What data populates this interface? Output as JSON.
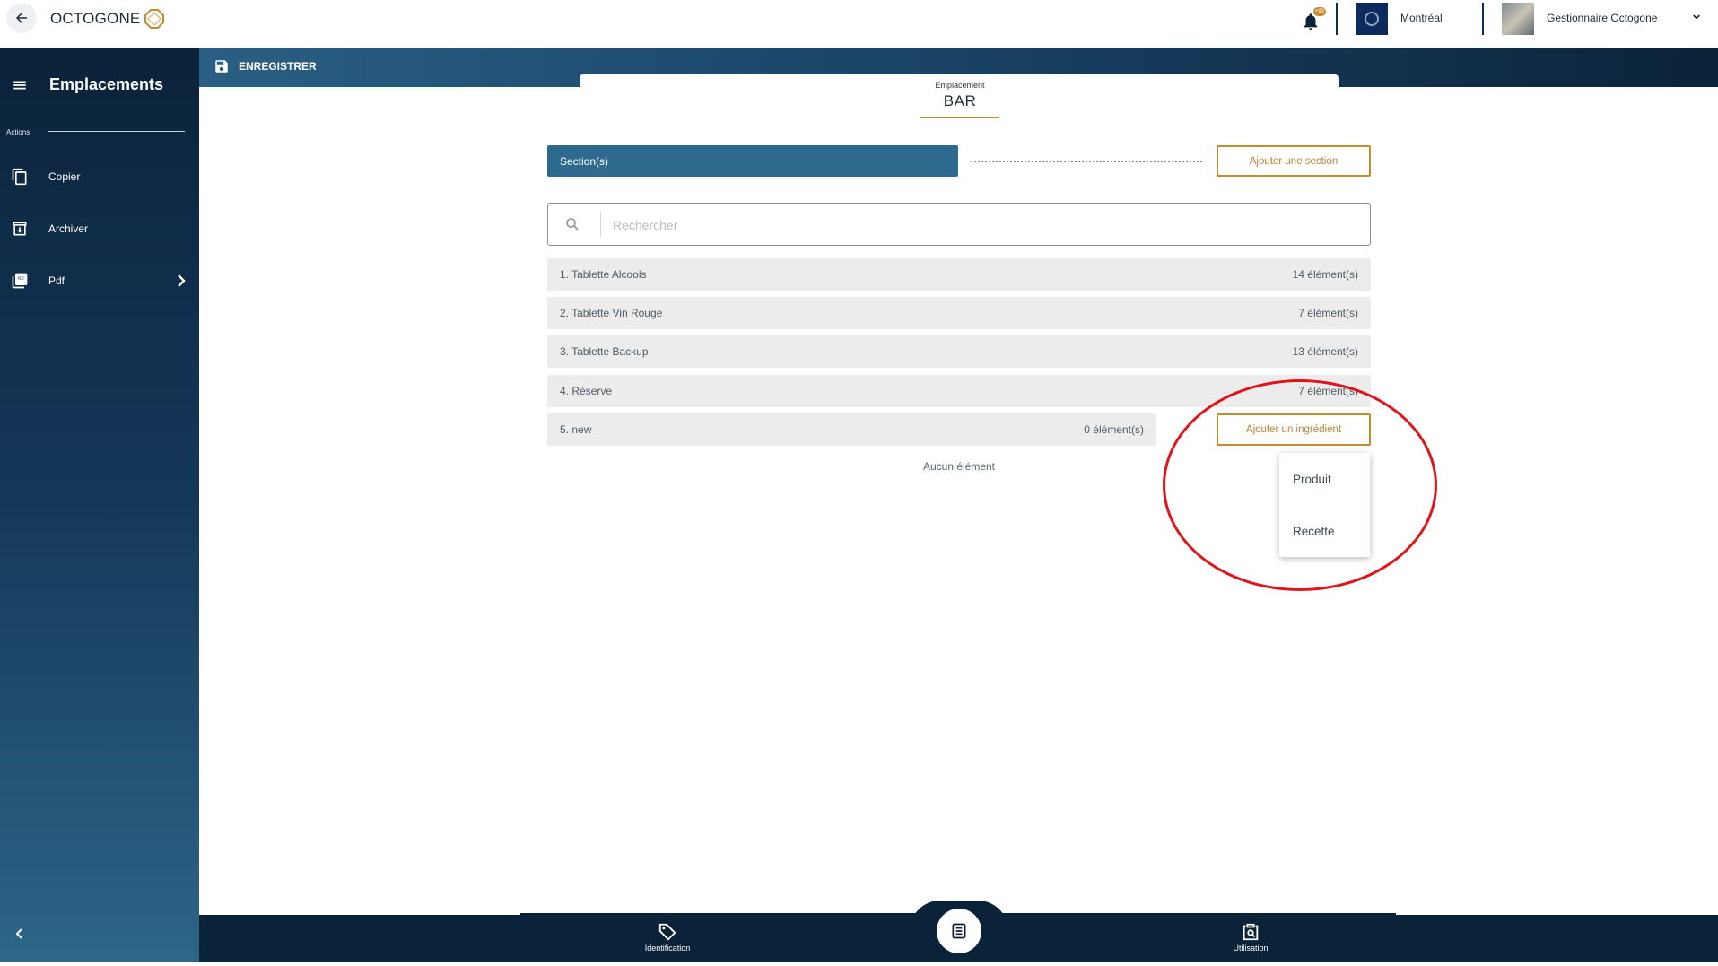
{
  "app": {
    "logo_text": "OCTOGONE"
  },
  "topbar": {
    "notification_badge": "+99",
    "location": "Montréal",
    "user": "Gestionnaire Octogone"
  },
  "sidebar": {
    "title": "Emplacements",
    "actions_label": "Actions",
    "items": [
      {
        "label": "Copier",
        "icon": "copy-icon"
      },
      {
        "label": "Archiver",
        "icon": "archive-icon"
      },
      {
        "label": "Pdf",
        "icon": "pdf-icon"
      }
    ]
  },
  "header": {
    "save_label": "ENREGISTRER"
  },
  "location": {
    "label": "Emplacement",
    "name": "BAR"
  },
  "sections": {
    "bar_label": "Section(s)",
    "add_section_label": "Ajouter une section",
    "search_placeholder": "Rechercher",
    "rows": [
      {
        "name": "1. Tablette Alcools",
        "count": "14 élément(s)"
      },
      {
        "name": "2. Tablette Vin Rouge",
        "count": "7 élément(s)"
      },
      {
        "name": "3. Tablette Backup",
        "count": "13 élément(s)"
      },
      {
        "name": "4. Réserve",
        "count": "7 élément(s)"
      },
      {
        "name": "5. new",
        "count": "0 élément(s)"
      }
    ],
    "add_ingredient_label": "Ajouter un ingrédient",
    "empty_text": "Aucun élément",
    "dropdown_options": [
      "Produit",
      "Recette"
    ]
  },
  "bottom_nav": {
    "left_label": "Identification",
    "right_label": "Utilisation"
  },
  "colors": {
    "navy": "#0b2339",
    "section_blue": "#2e6a8e",
    "accent_gold": "#c58b2f",
    "annotation_red": "#e0141d"
  }
}
